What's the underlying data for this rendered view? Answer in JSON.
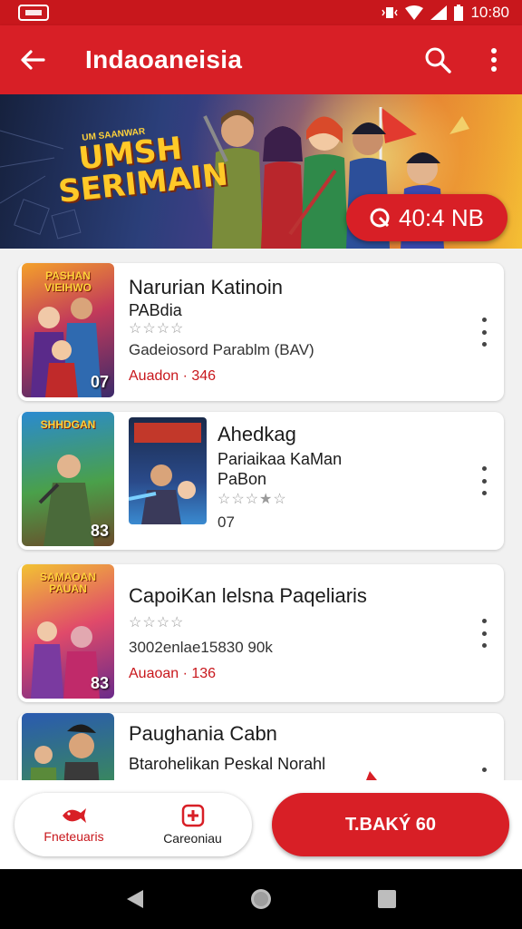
{
  "status_bar": {
    "time": "10:80",
    "logo_text": ""
  },
  "app_bar": {
    "title": "Indaoaneisia"
  },
  "banner": {
    "title_line1": "UMSH",
    "title_line2": "SERIMAIN",
    "tagline": "UM SAANWAR",
    "price": "40:4 NB"
  },
  "items": [
    {
      "title": "Narurian Katinoin",
      "subtitle": "PABdia",
      "rating_stars": "☆☆☆☆",
      "meta": "Gadeiosord Parablm (BAV)",
      "tag": "Auadon · 346",
      "thumb_number": "07",
      "thumb_logo": "PASHAN VIEIHWO"
    },
    {
      "title": "Ahedkag",
      "subtitle": "Pariaikaa KaMan",
      "subtitle2": "PaBon",
      "rating_stars": "☆☆☆★☆",
      "meta": "07",
      "thumb_number": "83",
      "thumb_logo": "SHHDGAN"
    },
    {
      "title": "CapoiKan lelsna Paqeliaris",
      "rating_stars": "☆☆☆☆",
      "meta": "3002enlae15830 90k",
      "tag": "Auaoan · 136",
      "thumb_number": "83",
      "thumb_logo": "SAMAOAN PAUAN"
    },
    {
      "title": "Paughania Cabn",
      "subtitle": "Btarohelikan Peskal Norahl",
      "thumb_number": ""
    }
  ],
  "bottom": {
    "left_label": "Fneteuaris",
    "right_label": "Careoniau",
    "cta_label": "T.BAKÝ 60"
  },
  "colors": {
    "accent": "#d81f26",
    "status": "#c8171c"
  }
}
